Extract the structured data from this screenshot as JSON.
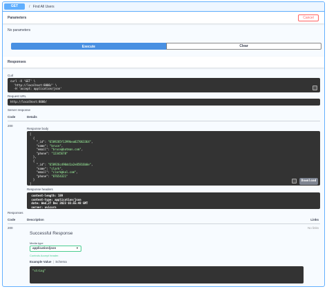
{
  "operation": {
    "method": "GET",
    "separator": "/",
    "summary": "Find All Users"
  },
  "parameters": {
    "title": "Parameters",
    "cancel_label": "Cancel",
    "empty_text": "No parameters"
  },
  "actions": {
    "execute_label": "Execute",
    "clear_label": "Clear"
  },
  "responses_title": "Responses",
  "curl": {
    "label": "Curl",
    "lines": [
      "curl -X 'GET' \\",
      "  'http://localhost:8000/' \\",
      "  -H 'accept: application/json'"
    ]
  },
  "request_url": {
    "label": "Request URL",
    "value": "http://localhost:8000/"
  },
  "server_response": {
    "label": "Server response",
    "code_header": "Code",
    "details_header": "Details",
    "code": "200",
    "body_label": "Response body",
    "body_lines": [
      "[",
      "  {",
      "    \"_id\": \"6589285f1399bea027063364\",",
      "    \"name\": \"bruce\",",
      "    \"email\": \"bruce@batman.com\",",
      "    \"phone\": \"12345678\"",
      "  },",
      "  {",
      "    \"_id\": \"658926c490dd1a2e05816b0e\",",
      "    \"name\": \"clark\",",
      "    \"email\": \"clark@kal.com\",",
      "    \"phone\": \"87654321\"",
      "  }",
      "]"
    ],
    "download_label": "Download",
    "headers_label": "Response headers",
    "header_lines": [
      " content-length: 189",
      " content-type: application/json",
      " date: Wed,27 Dec 2023 03:55:48 GMT",
      " server: uvicorn"
    ]
  },
  "documented_responses": {
    "title": "Responses",
    "code_header": "Code",
    "description_header": "Description",
    "links_header": "Links",
    "code": "200",
    "description": "Successful Response",
    "links_value": "No links",
    "media_type_label": "Media type",
    "media_type_value": "application/json",
    "accept_note": "Controls Accept header.",
    "example_value_label": "Example Value",
    "schema_label": "Schema",
    "example": "\"string\""
  },
  "colors": {
    "get_blue": "#61affe",
    "execute_blue": "#4990e2",
    "cancel_red": "#ff6060",
    "media_green": "#49cc90",
    "code_bg": "#333333"
  }
}
